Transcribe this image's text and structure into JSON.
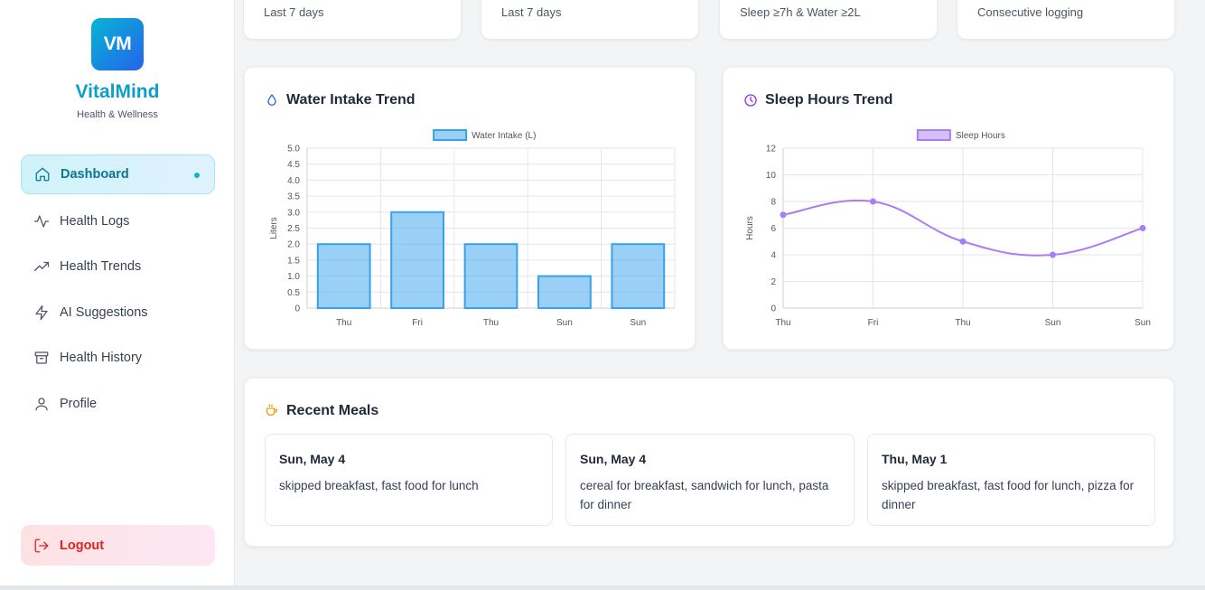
{
  "brand": {
    "initials": "VM",
    "name": "VitalMind",
    "tagline": "Health & Wellness"
  },
  "nav": {
    "items": [
      {
        "label": "Dashboard",
        "icon": "home-icon",
        "active": true
      },
      {
        "label": "Health Logs",
        "icon": "activity-icon",
        "active": false
      },
      {
        "label": "Health Trends",
        "icon": "trending-up-icon",
        "active": false
      },
      {
        "label": "AI Suggestions",
        "icon": "zap-icon",
        "active": false
      },
      {
        "label": "Health History",
        "icon": "archive-icon",
        "active": false
      },
      {
        "label": "Profile",
        "icon": "user-icon",
        "active": false
      }
    ],
    "logout_label": "Logout"
  },
  "stats": [
    {
      "subtitle": "Last 7 days"
    },
    {
      "subtitle": "Last 7 days"
    },
    {
      "subtitle": "Sleep ≥7h & Water ≥2L"
    },
    {
      "subtitle": "Consecutive logging"
    }
  ],
  "water_panel": {
    "title": "Water Intake Trend",
    "icon": "droplet-icon"
  },
  "sleep_panel": {
    "title": "Sleep Hours Trend",
    "icon": "clock-icon"
  },
  "chart_data": [
    {
      "type": "bar",
      "title": "",
      "legend": "Water Intake (L)",
      "legend_position": "top",
      "ylabel": "Liters",
      "xlabel": "",
      "categories": [
        "Thu",
        "Fri",
        "Thu",
        "Sun",
        "Sun"
      ],
      "values": [
        2.0,
        3.0,
        2.0,
        1.0,
        2.0
      ],
      "ylim": [
        0,
        5
      ],
      "yticks": [
        "0",
        "0.5",
        "1.0",
        "1.5",
        "2.0",
        "2.5",
        "3.0",
        "3.5",
        "4.0",
        "4.5",
        "5.0"
      ],
      "grid": true,
      "color": "#36a2eb"
    },
    {
      "type": "line",
      "title": "",
      "legend": "Sleep Hours",
      "legend_position": "top",
      "ylabel": "Hours",
      "xlabel": "",
      "categories": [
        "Thu",
        "Fri",
        "Thu",
        "Sun",
        "Sun"
      ],
      "values": [
        7,
        8,
        5,
        4,
        6
      ],
      "ylim": [
        0,
        12
      ],
      "yticks": [
        "0",
        "2",
        "4",
        "6",
        "8",
        "10",
        "12"
      ],
      "grid": true,
      "color": "#a97ef5"
    }
  ],
  "meals": {
    "title": "Recent Meals",
    "icon": "coffee-icon",
    "items": [
      {
        "date": "Sun, May 4",
        "description": "skipped breakfast, fast food for lunch"
      },
      {
        "date": "Sun, May 4",
        "description": "cereal for breakfast, sandwich for lunch, pasta for dinner"
      },
      {
        "date": "Thu, May 1",
        "description": "skipped breakfast, fast food for lunch, pizza for dinner"
      }
    ]
  }
}
